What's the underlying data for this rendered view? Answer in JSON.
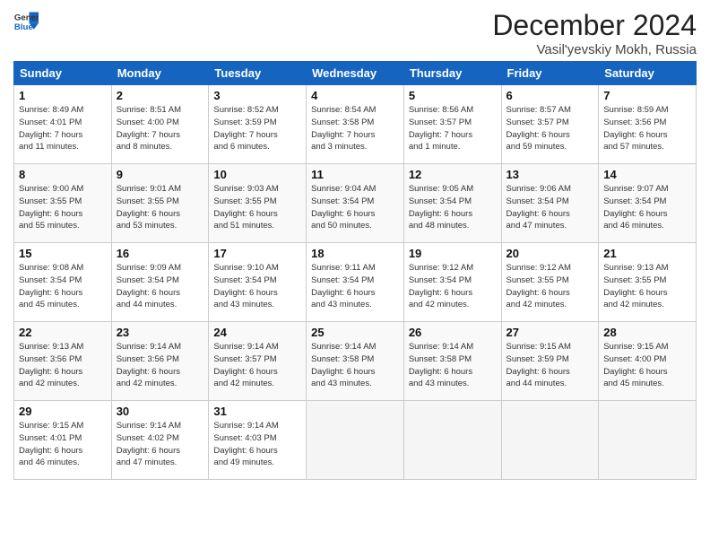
{
  "header": {
    "logo_line1": "General",
    "logo_line2": "Blue",
    "month": "December 2024",
    "location": "Vasil'yevskiy Mokh, Russia"
  },
  "weekdays": [
    "Sunday",
    "Monday",
    "Tuesday",
    "Wednesday",
    "Thursday",
    "Friday",
    "Saturday"
  ],
  "weeks": [
    [
      {
        "day": "1",
        "info": "Sunrise: 8:49 AM\nSunset: 4:01 PM\nDaylight: 7 hours\nand 11 minutes."
      },
      {
        "day": "2",
        "info": "Sunrise: 8:51 AM\nSunset: 4:00 PM\nDaylight: 7 hours\nand 8 minutes."
      },
      {
        "day": "3",
        "info": "Sunrise: 8:52 AM\nSunset: 3:59 PM\nDaylight: 7 hours\nand 6 minutes."
      },
      {
        "day": "4",
        "info": "Sunrise: 8:54 AM\nSunset: 3:58 PM\nDaylight: 7 hours\nand 3 minutes."
      },
      {
        "day": "5",
        "info": "Sunrise: 8:56 AM\nSunset: 3:57 PM\nDaylight: 7 hours\nand 1 minute."
      },
      {
        "day": "6",
        "info": "Sunrise: 8:57 AM\nSunset: 3:57 PM\nDaylight: 6 hours\nand 59 minutes."
      },
      {
        "day": "7",
        "info": "Sunrise: 8:59 AM\nSunset: 3:56 PM\nDaylight: 6 hours\nand 57 minutes."
      }
    ],
    [
      {
        "day": "8",
        "info": "Sunrise: 9:00 AM\nSunset: 3:55 PM\nDaylight: 6 hours\nand 55 minutes."
      },
      {
        "day": "9",
        "info": "Sunrise: 9:01 AM\nSunset: 3:55 PM\nDaylight: 6 hours\nand 53 minutes."
      },
      {
        "day": "10",
        "info": "Sunrise: 9:03 AM\nSunset: 3:55 PM\nDaylight: 6 hours\nand 51 minutes."
      },
      {
        "day": "11",
        "info": "Sunrise: 9:04 AM\nSunset: 3:54 PM\nDaylight: 6 hours\nand 50 minutes."
      },
      {
        "day": "12",
        "info": "Sunrise: 9:05 AM\nSunset: 3:54 PM\nDaylight: 6 hours\nand 48 minutes."
      },
      {
        "day": "13",
        "info": "Sunrise: 9:06 AM\nSunset: 3:54 PM\nDaylight: 6 hours\nand 47 minutes."
      },
      {
        "day": "14",
        "info": "Sunrise: 9:07 AM\nSunset: 3:54 PM\nDaylight: 6 hours\nand 46 minutes."
      }
    ],
    [
      {
        "day": "15",
        "info": "Sunrise: 9:08 AM\nSunset: 3:54 PM\nDaylight: 6 hours\nand 45 minutes."
      },
      {
        "day": "16",
        "info": "Sunrise: 9:09 AM\nSunset: 3:54 PM\nDaylight: 6 hours\nand 44 minutes."
      },
      {
        "day": "17",
        "info": "Sunrise: 9:10 AM\nSunset: 3:54 PM\nDaylight: 6 hours\nand 43 minutes."
      },
      {
        "day": "18",
        "info": "Sunrise: 9:11 AM\nSunset: 3:54 PM\nDaylight: 6 hours\nand 43 minutes."
      },
      {
        "day": "19",
        "info": "Sunrise: 9:12 AM\nSunset: 3:54 PM\nDaylight: 6 hours\nand 42 minutes."
      },
      {
        "day": "20",
        "info": "Sunrise: 9:12 AM\nSunset: 3:55 PM\nDaylight: 6 hours\nand 42 minutes."
      },
      {
        "day": "21",
        "info": "Sunrise: 9:13 AM\nSunset: 3:55 PM\nDaylight: 6 hours\nand 42 minutes."
      }
    ],
    [
      {
        "day": "22",
        "info": "Sunrise: 9:13 AM\nSunset: 3:56 PM\nDaylight: 6 hours\nand 42 minutes."
      },
      {
        "day": "23",
        "info": "Sunrise: 9:14 AM\nSunset: 3:56 PM\nDaylight: 6 hours\nand 42 minutes."
      },
      {
        "day": "24",
        "info": "Sunrise: 9:14 AM\nSunset: 3:57 PM\nDaylight: 6 hours\nand 42 minutes."
      },
      {
        "day": "25",
        "info": "Sunrise: 9:14 AM\nSunset: 3:58 PM\nDaylight: 6 hours\nand 43 minutes."
      },
      {
        "day": "26",
        "info": "Sunrise: 9:14 AM\nSunset: 3:58 PM\nDaylight: 6 hours\nand 43 minutes."
      },
      {
        "day": "27",
        "info": "Sunrise: 9:15 AM\nSunset: 3:59 PM\nDaylight: 6 hours\nand 44 minutes."
      },
      {
        "day": "28",
        "info": "Sunrise: 9:15 AM\nSunset: 4:00 PM\nDaylight: 6 hours\nand 45 minutes."
      }
    ],
    [
      {
        "day": "29",
        "info": "Sunrise: 9:15 AM\nSunset: 4:01 PM\nDaylight: 6 hours\nand 46 minutes."
      },
      {
        "day": "30",
        "info": "Sunrise: 9:14 AM\nSunset: 4:02 PM\nDaylight: 6 hours\nand 47 minutes."
      },
      {
        "day": "31",
        "info": "Sunrise: 9:14 AM\nSunset: 4:03 PM\nDaylight: 6 hours\nand 49 minutes."
      },
      {
        "day": "",
        "info": ""
      },
      {
        "day": "",
        "info": ""
      },
      {
        "day": "",
        "info": ""
      },
      {
        "day": "",
        "info": ""
      }
    ]
  ]
}
